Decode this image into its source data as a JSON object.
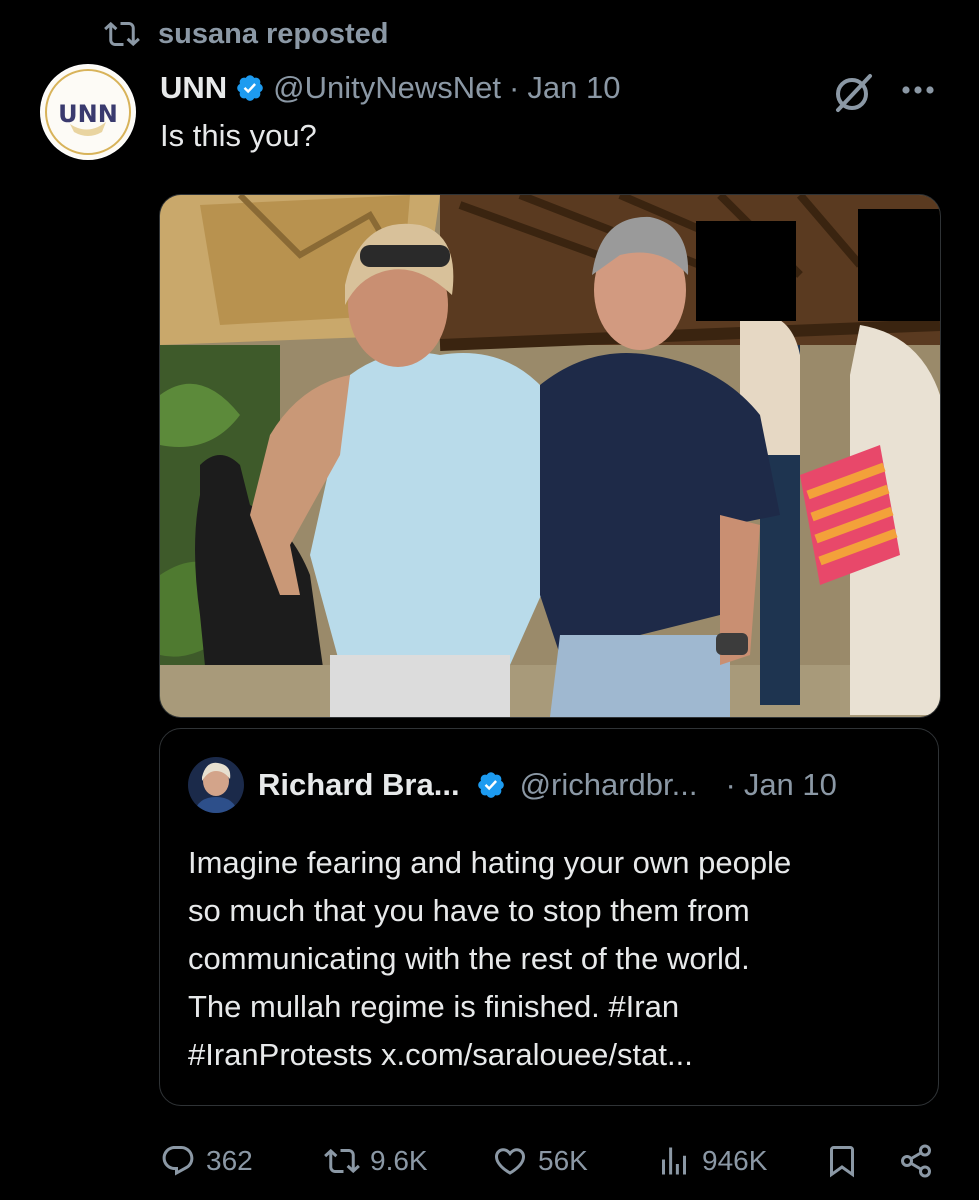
{
  "repost": {
    "icon": "repost-icon",
    "label": "susana reposted"
  },
  "tweet": {
    "avatar_icon": "unn-logo-avatar",
    "avatar_text": "UNN",
    "author_name": "UNN",
    "verified_icon": "verified-badge-icon",
    "handle": "@UnityNewsNet",
    "separator": "·",
    "date": "Jan 10",
    "grok_icon": "grok-icon",
    "more_icon": "more-icon",
    "text": "Is this you?",
    "media_label": "photo"
  },
  "quote": {
    "avatar_icon": "richard-avatar",
    "name": "Richard Bra...",
    "verified_icon": "verified-badge-icon",
    "handle": "@richardbr...",
    "separator": "·",
    "date": "Jan 10",
    "lines": [
      "Imagine fearing and hating your own people",
      "so much that you have to stop them from",
      "communicating with the rest of the world.",
      "The mullah regime is finished. #Iran",
      "#IranProtests x.com/saralouee/stat..."
    ]
  },
  "actions": {
    "replies": {
      "icon": "reply-icon",
      "count": "362"
    },
    "reposts": {
      "icon": "repost-icon",
      "count": "9.6K"
    },
    "likes": {
      "icon": "like-icon",
      "count": "56K"
    },
    "views": {
      "icon": "views-icon",
      "count": "946K"
    },
    "bookmark": {
      "icon": "bookmark-icon"
    },
    "share": {
      "icon": "share-icon"
    }
  },
  "colors": {
    "background": "#000000",
    "primary_text": "#e7e9ea",
    "secondary_text": "#8b98a5",
    "verified": "#1d9bf0",
    "border": "#2f3336"
  }
}
